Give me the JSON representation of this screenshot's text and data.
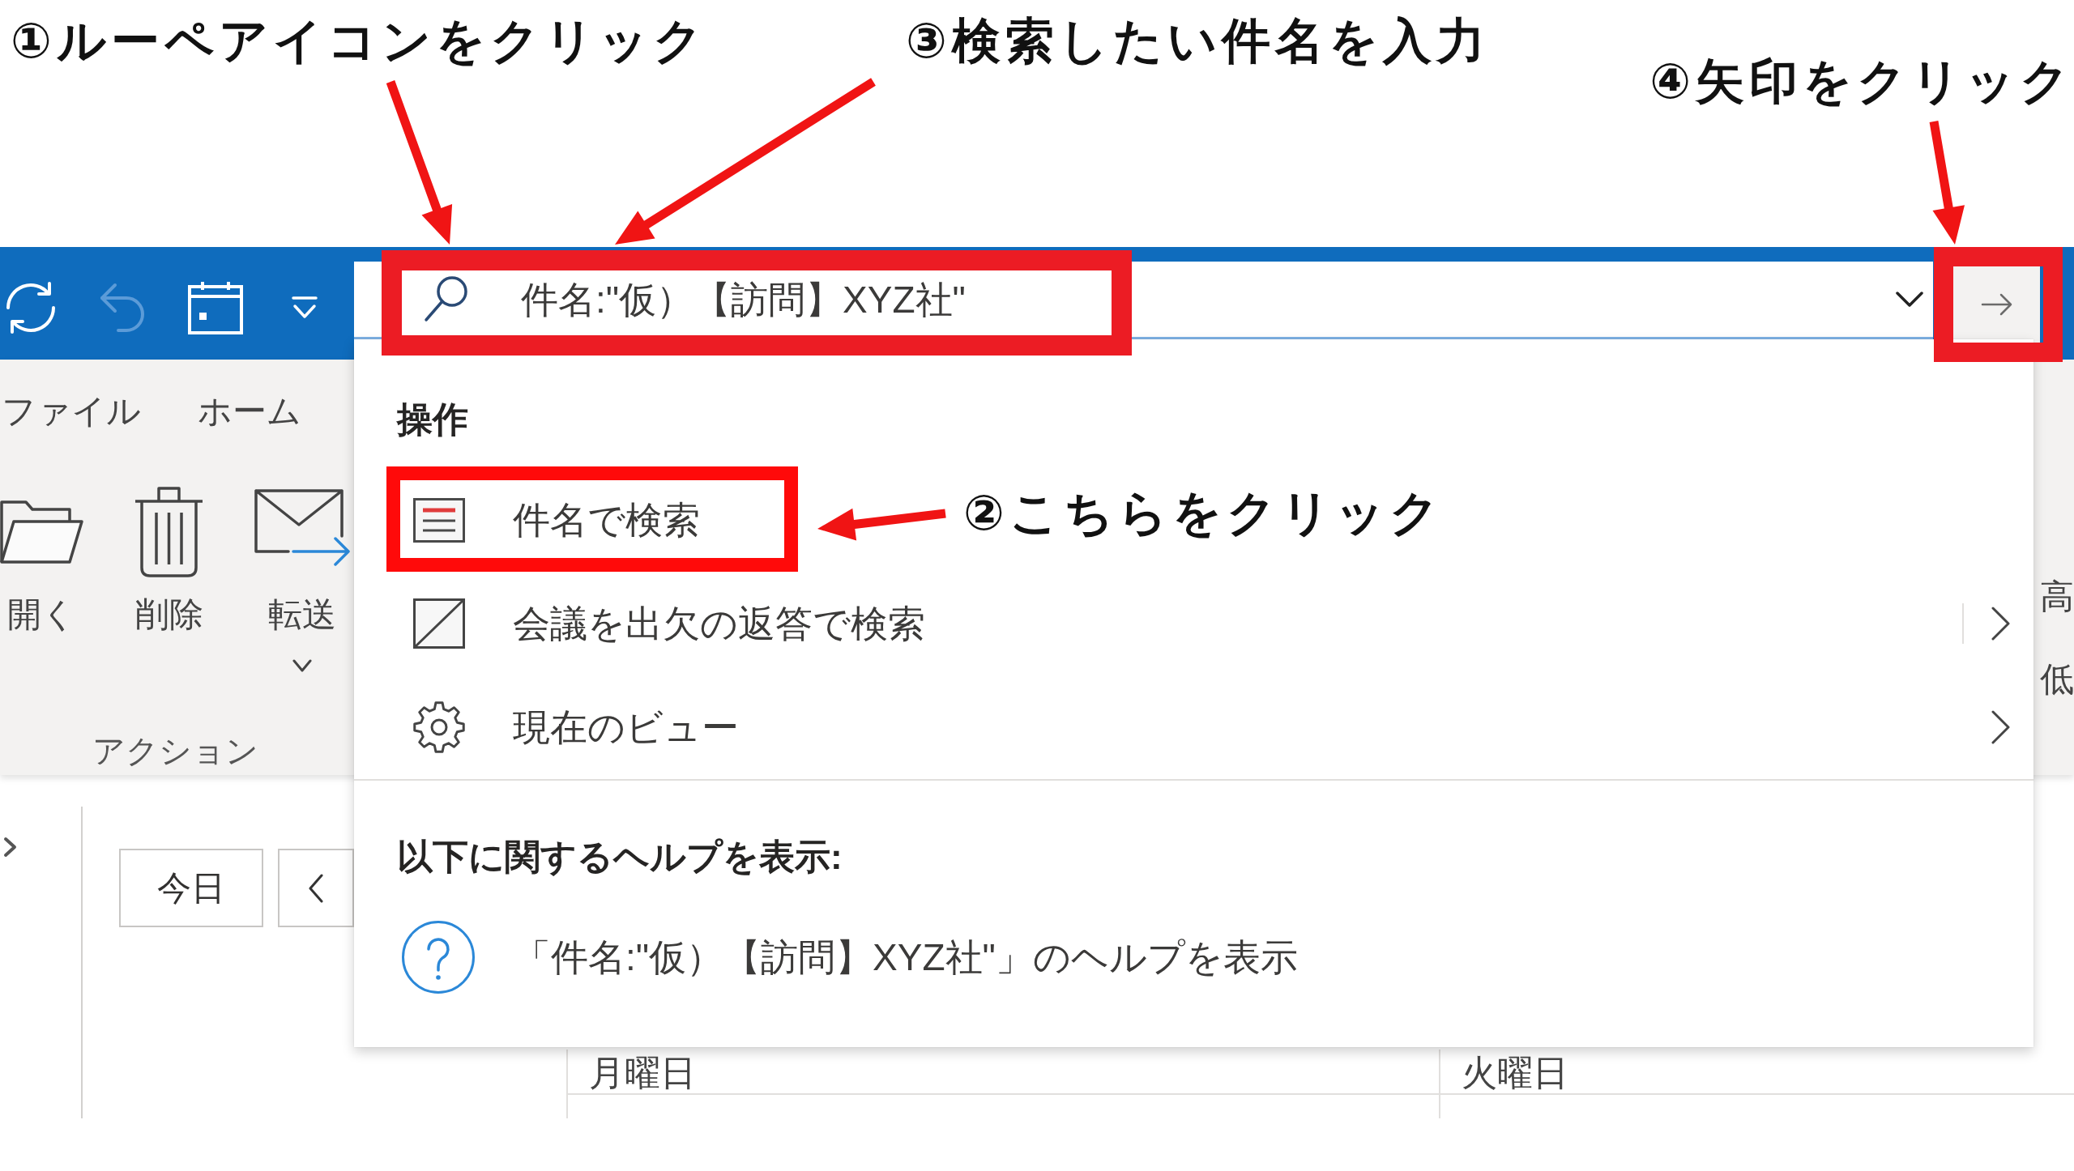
{
  "callouts": [
    "①ルーペアイコンをクリック",
    "③検索したい件名を入力",
    "④矢印をクリック",
    "②こちらをクリック"
  ],
  "toolbar": [
    {
      "kind": "refresh",
      "disabled": false
    },
    {
      "kind": "undo",
      "disabled": true
    },
    {
      "kind": "calendar",
      "disabled": false
    },
    {
      "kind": "customize",
      "disabled": false
    }
  ],
  "search": {
    "value": "件名:\"仮）【訪問】XYZ社\"",
    "highlighted": true
  },
  "go_button": {
    "highlighted": true
  },
  "ribbon": {
    "tabs": [
      "ファイル",
      "ホーム"
    ],
    "buttons": [
      {
        "kind": "open",
        "label": "開く",
        "has_menu": false
      },
      {
        "kind": "delete",
        "label": "削除",
        "has_menu": false
      },
      {
        "kind": "forward",
        "label": "転送",
        "has_menu": true
      }
    ],
    "group_label": "アクション",
    "edge_labels": [
      "高",
      "低"
    ]
  },
  "dropdown": {
    "sections": [
      {
        "heading": "操作",
        "items": [
          {
            "kind": "subject",
            "label": "件名で検索",
            "highlighted": true,
            "submenu": false,
            "split": false
          },
          {
            "kind": "meeting",
            "label": "会議を出欠の返答で検索",
            "highlighted": false,
            "submenu": true,
            "split": true
          },
          {
            "kind": "view",
            "label": "現在のビュー",
            "highlighted": false,
            "submenu": true,
            "split": false
          }
        ]
      },
      {
        "heading": "以下に関するヘルプを表示:",
        "items": [
          {
            "kind": "help",
            "label": "「件名:\"仮）【訪問】XYZ社\"」のヘルプを表示",
            "highlighted": false,
            "submenu": false,
            "split": false
          }
        ]
      }
    ]
  },
  "calendar": {
    "today_button": "今日",
    "days": [
      "月曜日",
      "火曜日"
    ]
  }
}
